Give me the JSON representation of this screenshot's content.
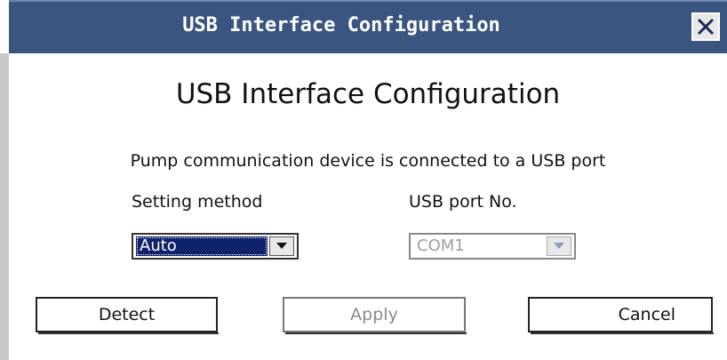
{
  "window": {
    "title": "USB Interface Configuration"
  },
  "dialog": {
    "heading": "USB Interface Configuration",
    "description": "Pump communication device is connected to a USB port",
    "setting_method": {
      "label": "Setting method",
      "selected": "Auto"
    },
    "usb_port": {
      "label": "USB port No.",
      "selected": "COM1"
    }
  },
  "buttons": {
    "detect": "Detect",
    "apply": "Apply",
    "cancel": "Cancel"
  },
  "colors": {
    "titlebar": "#3a5580",
    "selection": "#10226b",
    "disabled_text": "#9aa0a6"
  },
  "icons": {
    "close": "close-icon",
    "dropdown": "chevron-down-icon"
  }
}
